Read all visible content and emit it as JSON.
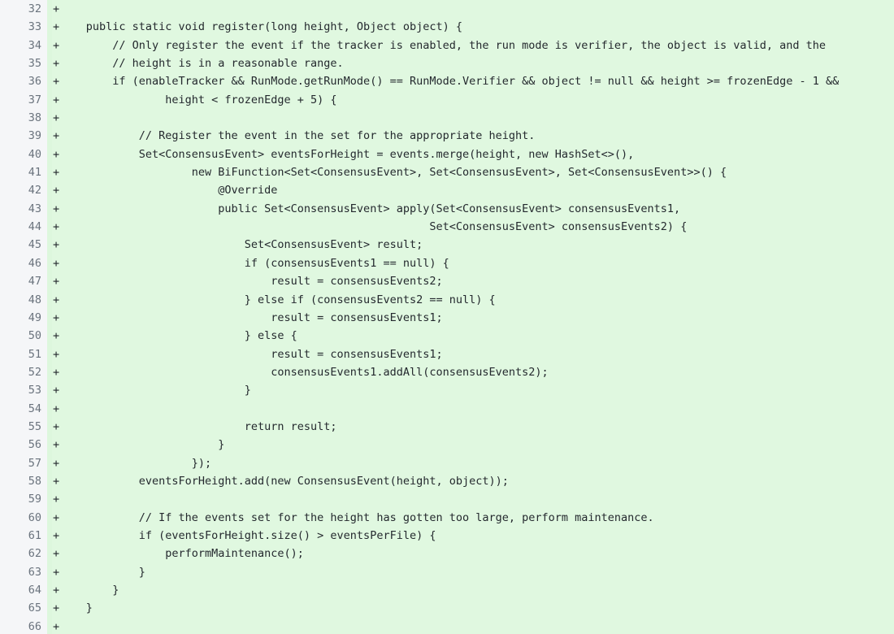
{
  "view": {
    "kind": "code-diff",
    "diff_type": "addition",
    "colors": {
      "gutter_bg": "#f5f6f8",
      "gutter_text": "#6a737d",
      "addition_bg": "#e0f8e0",
      "addition_marker_strip": "#ddf7dd",
      "code_text": "#24292e"
    },
    "line_marker": "+",
    "first_line_number": 32,
    "last_line_number": 66
  },
  "lines": [
    {
      "number": "32",
      "marker": "+",
      "code": ""
    },
    {
      "number": "33",
      "marker": "+",
      "code": "    public static void register(long height, Object object) {"
    },
    {
      "number": "34",
      "marker": "+",
      "code": "        // Only register the event if the tracker is enabled, the run mode is verifier, the object is valid, and the"
    },
    {
      "number": "35",
      "marker": "+",
      "code": "        // height is in a reasonable range."
    },
    {
      "number": "36",
      "marker": "+",
      "code": "        if (enableTracker && RunMode.getRunMode() == RunMode.Verifier && object != null && height >= frozenEdge - 1 &&"
    },
    {
      "number": "37",
      "marker": "+",
      "code": "                height < frozenEdge + 5) {"
    },
    {
      "number": "38",
      "marker": "+",
      "code": ""
    },
    {
      "number": "39",
      "marker": "+",
      "code": "            // Register the event in the set for the appropriate height."
    },
    {
      "number": "40",
      "marker": "+",
      "code": "            Set<ConsensusEvent> eventsForHeight = events.merge(height, new HashSet<>(),"
    },
    {
      "number": "41",
      "marker": "+",
      "code": "                    new BiFunction<Set<ConsensusEvent>, Set<ConsensusEvent>, Set<ConsensusEvent>>() {"
    },
    {
      "number": "42",
      "marker": "+",
      "code": "                        @Override"
    },
    {
      "number": "43",
      "marker": "+",
      "code": "                        public Set<ConsensusEvent> apply(Set<ConsensusEvent> consensusEvents1,"
    },
    {
      "number": "44",
      "marker": "+",
      "code": "                                                        Set<ConsensusEvent> consensusEvents2) {"
    },
    {
      "number": "45",
      "marker": "+",
      "code": "                            Set<ConsensusEvent> result;"
    },
    {
      "number": "46",
      "marker": "+",
      "code": "                            if (consensusEvents1 == null) {"
    },
    {
      "number": "47",
      "marker": "+",
      "code": "                                result = consensusEvents2;"
    },
    {
      "number": "48",
      "marker": "+",
      "code": "                            } else if (consensusEvents2 == null) {"
    },
    {
      "number": "49",
      "marker": "+",
      "code": "                                result = consensusEvents1;"
    },
    {
      "number": "50",
      "marker": "+",
      "code": "                            } else {"
    },
    {
      "number": "51",
      "marker": "+",
      "code": "                                result = consensusEvents1;"
    },
    {
      "number": "52",
      "marker": "+",
      "code": "                                consensusEvents1.addAll(consensusEvents2);"
    },
    {
      "number": "53",
      "marker": "+",
      "code": "                            }"
    },
    {
      "number": "54",
      "marker": "+",
      "code": ""
    },
    {
      "number": "55",
      "marker": "+",
      "code": "                            return result;"
    },
    {
      "number": "56",
      "marker": "+",
      "code": "                        }"
    },
    {
      "number": "57",
      "marker": "+",
      "code": "                    });"
    },
    {
      "number": "58",
      "marker": "+",
      "code": "            eventsForHeight.add(new ConsensusEvent(height, object));"
    },
    {
      "number": "59",
      "marker": "+",
      "code": ""
    },
    {
      "number": "60",
      "marker": "+",
      "code": "            // If the events set for the height has gotten too large, perform maintenance."
    },
    {
      "number": "61",
      "marker": "+",
      "code": "            if (eventsForHeight.size() > eventsPerFile) {"
    },
    {
      "number": "62",
      "marker": "+",
      "code": "                performMaintenance();"
    },
    {
      "number": "63",
      "marker": "+",
      "code": "            }"
    },
    {
      "number": "64",
      "marker": "+",
      "code": "        }"
    },
    {
      "number": "65",
      "marker": "+",
      "code": "    }"
    },
    {
      "number": "66",
      "marker": "+",
      "code": ""
    }
  ]
}
